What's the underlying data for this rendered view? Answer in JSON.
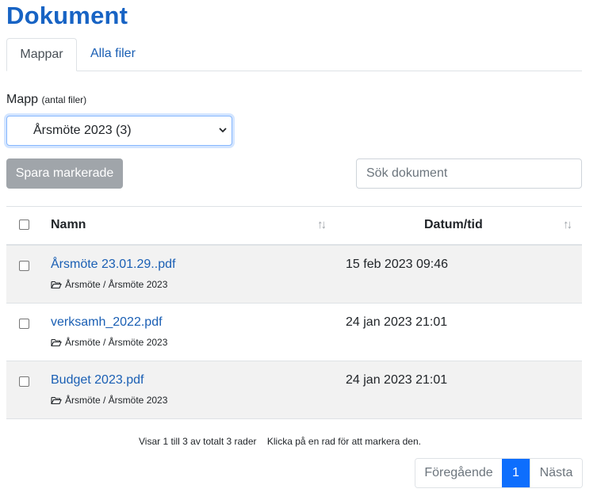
{
  "page": {
    "title": "Dokument"
  },
  "tabs": [
    {
      "label": "Mappar",
      "active": true
    },
    {
      "label": "Alla filer",
      "active": false
    }
  ],
  "folder": {
    "label": "Mapp",
    "label_hint": "(antal filer)",
    "selected": "Årsmöte 2023 (3)"
  },
  "toolbar": {
    "save_label": "Spara markerade",
    "search_placeholder": "Sök dokument"
  },
  "table": {
    "columns": {
      "name": "Namn",
      "date": "Datum/tid"
    },
    "rows": [
      {
        "name": "Årsmöte 23.01.29..pdf",
        "path": "Årsmöte / Årsmöte 2023",
        "date": "15 feb 2023 09:46"
      },
      {
        "name": "verksamh_2022.pdf",
        "path": "Årsmöte / Årsmöte 2023",
        "date": "24 jan 2023 21:01"
      },
      {
        "name": "Budget 2023.pdf",
        "path": "Årsmöte / Årsmöte 2023",
        "date": "24 jan 2023 21:01"
      }
    ]
  },
  "footer": {
    "info": "Visar 1 till 3 av totalt 3 rader",
    "hint": "Klicka på en rad för att markera den."
  },
  "pagination": {
    "prev": "Föregående",
    "current": "1",
    "next": "Nästa"
  },
  "colors": {
    "accent": "#1763c4",
    "link": "#1a5fb4",
    "primary": "#0d6efd",
    "button_disabled": "#a0a5aa"
  }
}
